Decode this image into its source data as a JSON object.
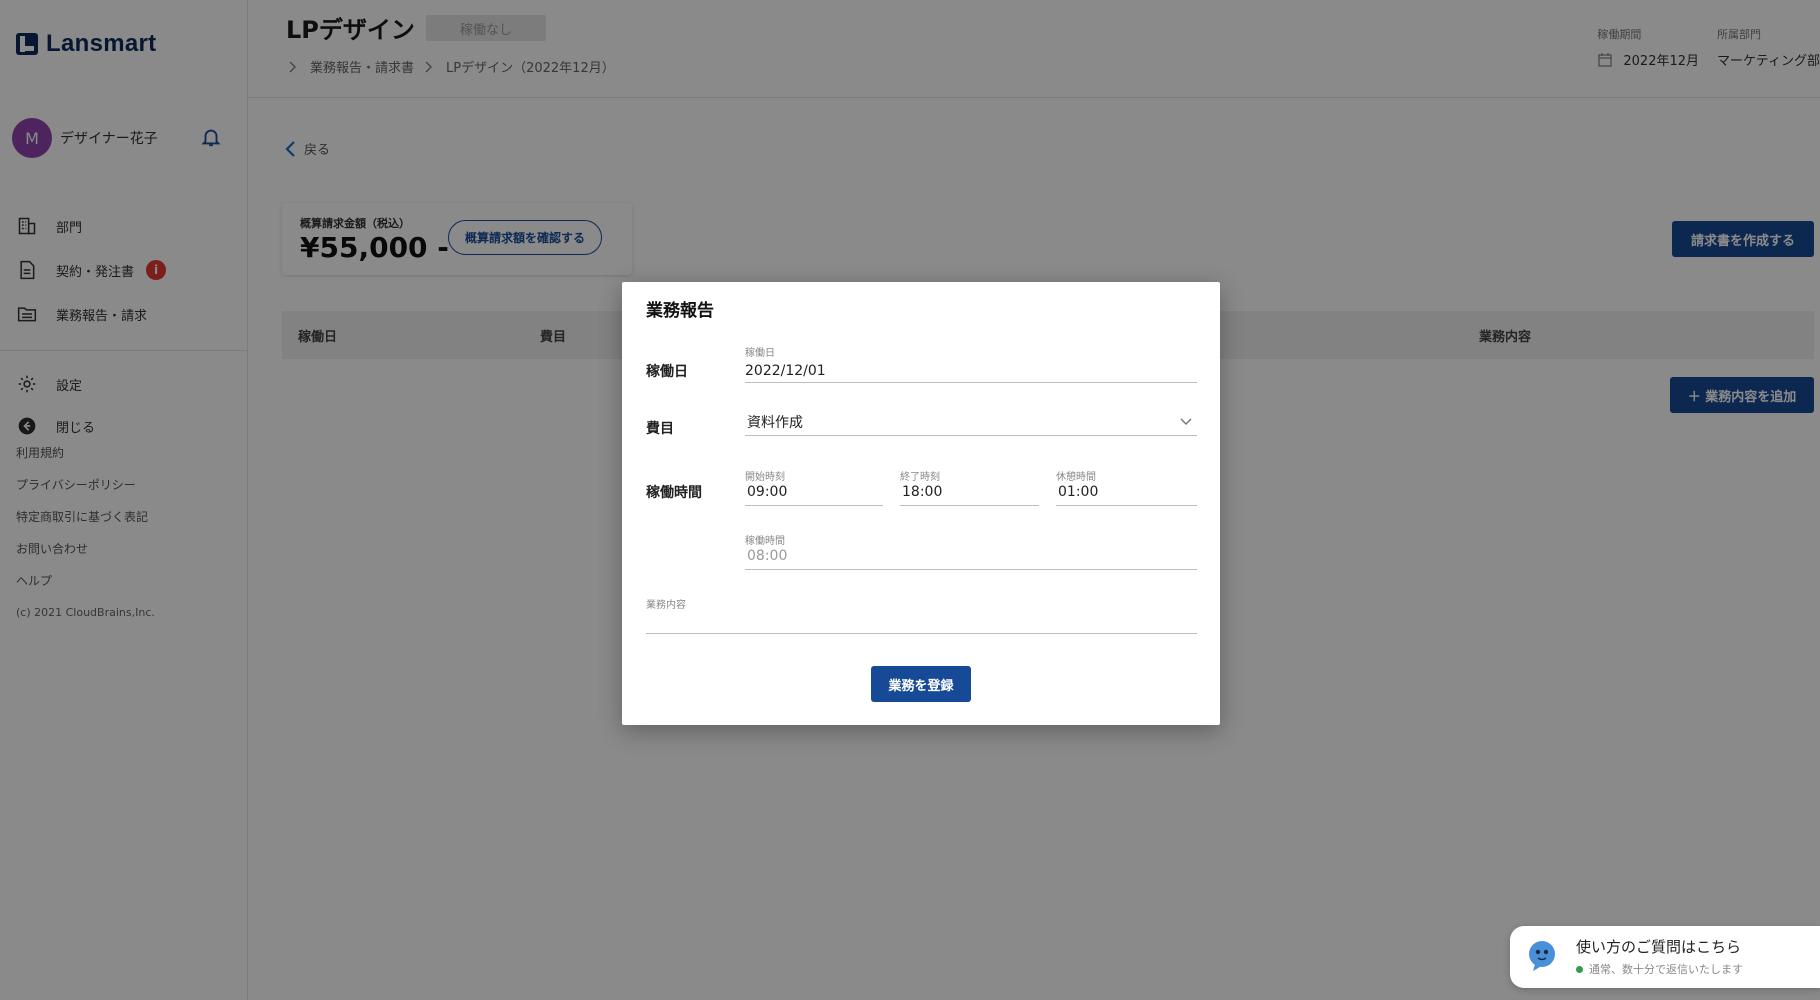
{
  "app": {
    "logo_text": "Lansmart"
  },
  "user": {
    "initial": "M",
    "name": "デザイナー花子"
  },
  "sidebar": {
    "items": [
      {
        "label": "部門"
      },
      {
        "label": "契約・発注書",
        "badge": "i"
      },
      {
        "label": "業務報告・請求"
      }
    ],
    "secondary": [
      {
        "label": "設定"
      },
      {
        "label": "閉じる"
      }
    ],
    "links": [
      "利用規約",
      "プライバシーポリシー",
      "特定商取引に基づく表記",
      "お問い合わせ",
      "ヘルプ"
    ],
    "copyright": "(c) 2021 CloudBrains,Inc."
  },
  "header": {
    "title": "LPデザイン",
    "status": "稼働なし",
    "breadcrumb": [
      "業務報告・請求書",
      "LPデザイン（2022年12月）"
    ],
    "period_label": "稼働期間",
    "period_value": "2022年12月",
    "dept_label": "所属部門",
    "dept_value": "マーケティング部"
  },
  "main": {
    "back_label": "戻る",
    "estimate_label": "概算請求金額（税込）",
    "estimate_amount": "¥55,000 -",
    "estimate_button": "概算請求額を確認する",
    "invoice_button": "請求書を作成する",
    "table_headers": [
      "稼働日",
      "費目",
      "業務内容"
    ],
    "add_button": "＋ 業務内容を追加"
  },
  "modal": {
    "title": "業務報告",
    "date_label": "稼働日",
    "date_field_label": "稼働日",
    "date_value": "2022/12/01",
    "category_label": "費目",
    "category_value": "資料作成",
    "time_label": "稼働時間",
    "start_label": "開始時刻",
    "start_value": "09:00",
    "end_label": "終了時刻",
    "end_value": "18:00",
    "break_label": "休憩時間",
    "break_value": "01:00",
    "work_hours_label": "稼働時間",
    "work_hours_value": "08:00",
    "content_label": "業務内容",
    "content_value": "",
    "submit": "業務を登録"
  },
  "chat": {
    "title": "使い方のご質問はこちら",
    "subtitle": "通常、数十分で返信いたします",
    "status_color": "#2e9d4c"
  },
  "colors": {
    "primary": "#174a96",
    "brand": "#0d2a5c",
    "badge": "#e53935",
    "avatar": "#8e44ad"
  }
}
